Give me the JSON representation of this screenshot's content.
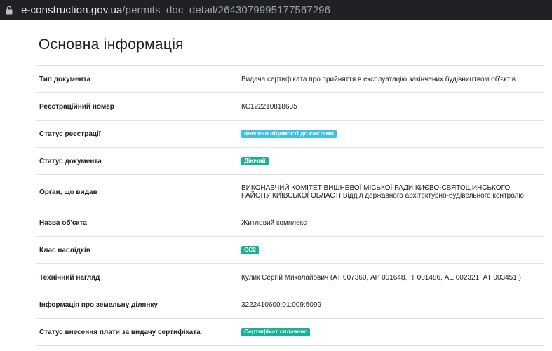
{
  "browser": {
    "url_domain": "e-construction.gov.ua",
    "url_path": "/permits_doc_detail/2643079995177567296"
  },
  "page": {
    "title": "Основна інформація",
    "rows": {
      "doc_type": {
        "label": "Тип документа",
        "value": "Видача сертифіката про прийняття в експлуатацію закінчених будівництвом об'єктів"
      },
      "reg_number": {
        "label": "Реєстраційний номер",
        "value": "КС122210818635"
      },
      "reg_status": {
        "label": "Статус реєстрації",
        "badge": "внесено відомості до системи",
        "color": "#3ec0e3"
      },
      "doc_status": {
        "label": "Статус документа",
        "badge": "Діючий",
        "color": "#18b193"
      },
      "issuer": {
        "label": "Орган, що видав",
        "value": "ВИКОНАВЧИЙ КОМІТЕТ ВИШНЕВОЇ МІСЬКОЇ РАДИ КИЄВО-СВЯТОШИНСЬКОГО РАЙОНУ КИЇВСЬКОЇ ОБЛАСТІ Відділ державного архітектурно-будівельного контролю"
      },
      "object_name": {
        "label": "Назва об'єкта",
        "value": "Житловий комплекс"
      },
      "consequence_class": {
        "label": "Клас наслідків",
        "badge": "СС2",
        "color": "#18b193"
      },
      "supervision": {
        "label": "Технічний нагляд",
        "value": "Кулик Сергій Миколайович (АТ 007360, АР 001648, ІТ 001486, АЕ 002321, АТ 003451 )"
      },
      "land_info": {
        "label": "Інформація про земельну ділянку",
        "value": "3222410600:01:009:5099"
      },
      "fee_status": {
        "label": "Статус внесення плати за видачу сертифіката",
        "badge": "Сертифікат сплачено",
        "color": "#18b193"
      }
    }
  }
}
